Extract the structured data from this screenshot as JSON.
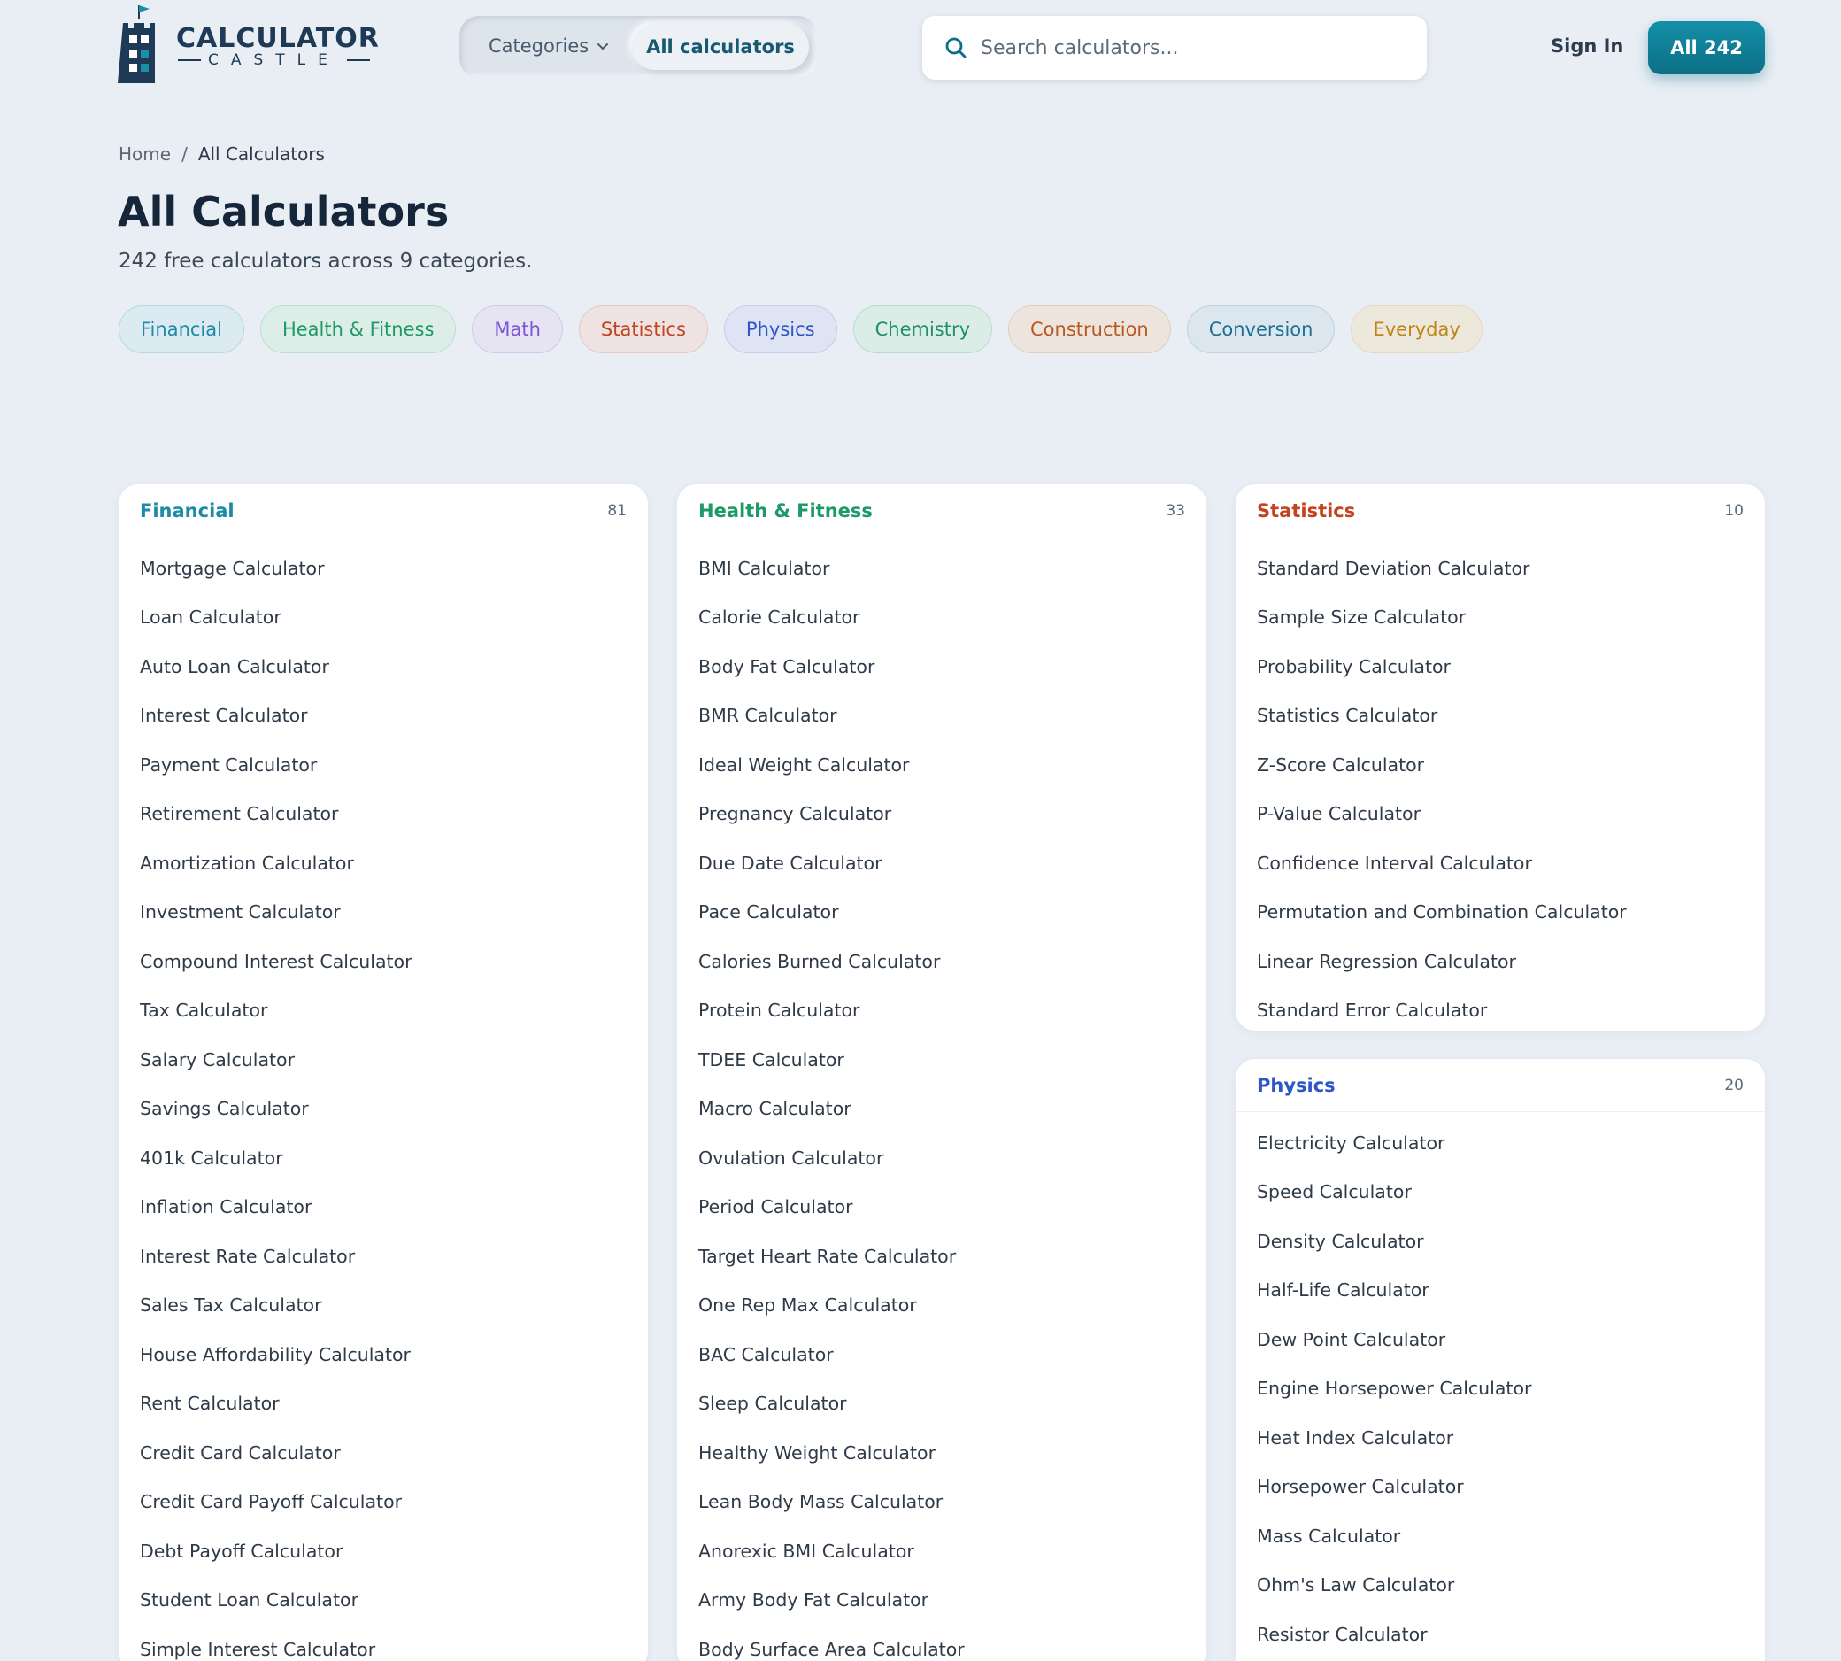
{
  "header": {
    "logo_text": "CALCULATOR",
    "logo_subtext": "CASTLE",
    "nav_categories": "Categories",
    "nav_all": "All calculators",
    "search_placeholder": "Search calculators...",
    "sign_in": "Sign In",
    "all_button": "All 242"
  },
  "breadcrumb": {
    "home": "Home",
    "separator": "/",
    "current": "All Calculators"
  },
  "page": {
    "title": "All Calculators",
    "subtitle": "242 free calculators across 9 categories."
  },
  "chips": [
    {
      "label": "Financial",
      "color": "#1d8aa6",
      "bg": "#dcebf2",
      "border": "#b6d8e4"
    },
    {
      "label": "Health & Fitness",
      "color": "#1e9a68",
      "bg": "#ddeee8",
      "border": "#bbdfd0"
    },
    {
      "label": "Math",
      "color": "#7a55d4",
      "bg": "#e6e3f3",
      "border": "#d0c8ec"
    },
    {
      "label": "Statistics",
      "color": "#c4431f",
      "bg": "#eee3e2",
      "border": "#e2c9c2"
    },
    {
      "label": "Physics",
      "color": "#2f56c6",
      "bg": "#dee4f3",
      "border": "#c2ceec"
    },
    {
      "label": "Chemistry",
      "color": "#1e9070",
      "bg": "#dcece6",
      "border": "#b7dccd"
    },
    {
      "label": "Construction",
      "color": "#b9591f",
      "bg": "#ede4de",
      "border": "#e2cdbd"
    },
    {
      "label": "Conversion",
      "color": "#1f6f8f",
      "bg": "#dbe6ee",
      "border": "#bcd2df"
    },
    {
      "label": "Everyday",
      "color": "#c08416",
      "bg": "#ede8dc",
      "border": "#e6d9b9"
    }
  ],
  "cards": {
    "financial": {
      "title": "Financial",
      "count": "81",
      "color": "#1d8aa6",
      "items": [
        "Mortgage Calculator",
        "Loan Calculator",
        "Auto Loan Calculator",
        "Interest Calculator",
        "Payment Calculator",
        "Retirement Calculator",
        "Amortization Calculator",
        "Investment Calculator",
        "Compound Interest Calculator",
        "Tax Calculator",
        "Salary Calculator",
        "Savings Calculator",
        "401k Calculator",
        "Inflation Calculator",
        "Interest Rate Calculator",
        "Sales Tax Calculator",
        "House Affordability Calculator",
        "Rent Calculator",
        "Credit Card Calculator",
        "Credit Card Payoff Calculator",
        "Debt Payoff Calculator",
        "Student Loan Calculator",
        "Simple Interest Calculator"
      ]
    },
    "health": {
      "title": "Health & Fitness",
      "count": "33",
      "color": "#1e9a68",
      "items": [
        "BMI Calculator",
        "Calorie Calculator",
        "Body Fat Calculator",
        "BMR Calculator",
        "Ideal Weight Calculator",
        "Pregnancy Calculator",
        "Due Date Calculator",
        "Pace Calculator",
        "Calories Burned Calculator",
        "Protein Calculator",
        "TDEE Calculator",
        "Macro Calculator",
        "Ovulation Calculator",
        "Period Calculator",
        "Target Heart Rate Calculator",
        "One Rep Max Calculator",
        "BAC Calculator",
        "Sleep Calculator",
        "Healthy Weight Calculator",
        "Lean Body Mass Calculator",
        "Anorexic BMI Calculator",
        "Army Body Fat Calculator",
        "Body Surface Area Calculator"
      ]
    },
    "statistics": {
      "title": "Statistics",
      "count": "10",
      "color": "#c4431f",
      "items": [
        "Standard Deviation Calculator",
        "Sample Size Calculator",
        "Probability Calculator",
        "Statistics Calculator",
        "Z-Score Calculator",
        "P-Value Calculator",
        "Confidence Interval Calculator",
        "Permutation and Combination Calculator",
        "Linear Regression Calculator",
        "Standard Error Calculator"
      ]
    },
    "physics": {
      "title": "Physics",
      "count": "20",
      "color": "#2f56c6",
      "items": [
        "Electricity Calculator",
        "Speed Calculator",
        "Density Calculator",
        "Half-Life Calculator",
        "Dew Point Calculator",
        "Engine Horsepower Calculator",
        "Heat Index Calculator",
        "Horsepower Calculator",
        "Mass Calculator",
        "Ohm's Law Calculator",
        "Resistor Calculator"
      ]
    }
  },
  "colors": {
    "accent": "#0b6f86",
    "background": "#e9eef4",
    "logo": "#1e3a56"
  }
}
